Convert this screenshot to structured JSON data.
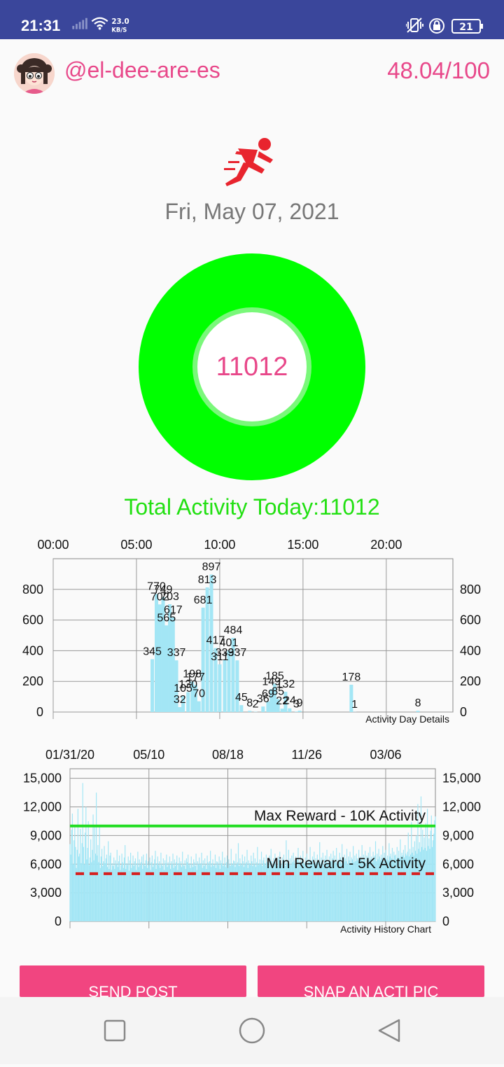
{
  "status_bar": {
    "time": "21:31",
    "net_speed_value": "23.0",
    "net_speed_unit": "KB/S",
    "battery": "21"
  },
  "profile": {
    "username": "@el-dee-are-es",
    "score": "48.04/100"
  },
  "date": "Fri, May 07, 2021",
  "activity_ring": {
    "value": "11012",
    "fill_fraction": 1.0
  },
  "total_activity": "Total Activity Today:11012",
  "colors": {
    "accent_pink": "#e8488a",
    "ring_green": "#00ff00",
    "bar_cyan": "#a3e6f5",
    "max_line": "#22dd22",
    "min_line": "#d62020",
    "status_bar": "#3a469b"
  },
  "chart_data": [
    {
      "type": "bar",
      "caption": "Activity Day Details",
      "x_ticks": [
        "00:00",
        "05:00",
        "10:00",
        "15:00",
        "20:00"
      ],
      "x_range_hours": [
        0,
        24
      ],
      "y_ticks": [
        "0",
        "200",
        "400",
        "600",
        "800"
      ],
      "ylim": [
        0,
        1000
      ],
      "bar_width_hours": 0.21,
      "bars": [
        {
          "t": 5.95,
          "v": 345,
          "label": "345"
        },
        {
          "t": 6.2,
          "v": 770,
          "label": "770"
        },
        {
          "t": 6.4,
          "v": 702,
          "label": "702"
        },
        {
          "t": 6.6,
          "v": 749,
          "label": "749"
        },
        {
          "t": 6.8,
          "v": 565,
          "label": "565"
        },
        {
          "t": 7.0,
          "v": 703,
          "label": "703"
        },
        {
          "t": 7.2,
          "v": 617,
          "label": "617"
        },
        {
          "t": 7.4,
          "v": 337,
          "label": "337"
        },
        {
          "t": 7.6,
          "v": 32,
          "label": "32"
        },
        {
          "t": 7.8,
          "v": 105,
          "label": "105"
        },
        {
          "t": 8.1,
          "v": 130,
          "label": "130"
        },
        {
          "t": 8.35,
          "v": 198,
          "label": "198"
        },
        {
          "t": 8.55,
          "v": 177,
          "label": "177"
        },
        {
          "t": 8.75,
          "v": 70,
          "label": "70"
        },
        {
          "t": 9.0,
          "v": 681,
          "label": "681"
        },
        {
          "t": 9.25,
          "v": 813,
          "label": "813"
        },
        {
          "t": 9.5,
          "v": 897,
          "label": "897"
        },
        {
          "t": 9.75,
          "v": 417,
          "label": "417"
        },
        {
          "t": 10.0,
          "v": 311,
          "label": "311"
        },
        {
          "t": 10.3,
          "v": 339,
          "label": "339"
        },
        {
          "t": 10.55,
          "v": 401,
          "label": "401"
        },
        {
          "t": 10.8,
          "v": 484,
          "label": "484"
        },
        {
          "t": 11.05,
          "v": 337,
          "label": "337"
        },
        {
          "t": 11.3,
          "v": 45,
          "label": "45"
        },
        {
          "t": 11.8,
          "v": 8,
          "label": "8"
        },
        {
          "t": 12.15,
          "v": 2,
          "label": "2"
        },
        {
          "t": 12.6,
          "v": 36,
          "label": "36"
        },
        {
          "t": 12.9,
          "v": 69,
          "label": "69"
        },
        {
          "t": 13.1,
          "v": 149,
          "label": "149"
        },
        {
          "t": 13.3,
          "v": 185,
          "label": "185"
        },
        {
          "t": 13.5,
          "v": 85,
          "label": "85"
        },
        {
          "t": 13.75,
          "v": 22,
          "label": "22"
        },
        {
          "t": 13.95,
          "v": 132,
          "label": "132"
        },
        {
          "t": 14.2,
          "v": 24,
          "label": "24"
        },
        {
          "t": 14.6,
          "v": 3,
          "label": "3"
        },
        {
          "t": 14.8,
          "v": 9,
          "label": "9"
        },
        {
          "t": 17.9,
          "v": 178,
          "label": "178"
        },
        {
          "t": 18.1,
          "v": 1,
          "label": "1"
        },
        {
          "t": 21.9,
          "v": 8,
          "label": "8"
        }
      ]
    },
    {
      "type": "bar",
      "caption": "Activity History Chart",
      "x_ticks": [
        "01/31/20",
        "05/10",
        "08/18",
        "11/26",
        "03/06"
      ],
      "ylim": [
        0,
        16000
      ],
      "y_ticks": [
        "0",
        "3,000",
        "6,000",
        "9,000",
        "12,000",
        "15,000"
      ],
      "first_date": "01/31/20",
      "last_date": "05/07/21",
      "days": 463,
      "bar_width_days": 0.6,
      "values": [
        8100,
        7000,
        9600,
        11300,
        6000,
        8500,
        9900,
        7800,
        5600,
        7500,
        11800,
        6800,
        7100,
        9700,
        6100,
        8200,
        14500,
        7800,
        6000,
        9300,
        12000,
        6500,
        7700,
        10500,
        5900,
        6700,
        8600,
        6200,
        7500,
        11200,
        6400,
        9900,
        7100,
        13500,
        6900,
        8000,
        6200,
        10100,
        5600,
        6800,
        7600,
        5800,
        6300,
        7900,
        6100,
        6600,
        7000,
        5700,
        8400,
        5500,
        6900,
        7200,
        5400,
        6100,
        5800,
        6700,
        5500,
        6400,
        6000,
        7500,
        5700,
        6300,
        6900,
        5400,
        5900,
        7100,
        6200,
        5600,
        6700,
        8000,
        5500,
        6100,
        5900,
        6800,
        5300,
        6400,
        7200,
        5600,
        6000,
        6900,
        5800,
        6300,
        6600,
        5400,
        6100,
        7300,
        5700,
        6500,
        5900,
        6200,
        6800,
        5500,
        7000,
        6000,
        5800,
        6400,
        7100,
        5600,
        6300,
        5900,
        6700,
        5400,
        6200,
        6900,
        5700,
        6000,
        6500,
        7400,
        5500,
        6100,
        6800,
        5900,
        6300,
        5600,
        7200,
        6000,
        5800,
        6600,
        5400,
        6400,
        6100,
        7000,
        5700,
        6200,
        5900,
        6800,
        5500,
        6300,
        6000,
        7100,
        5600,
        6500,
        5800,
        6200,
        6900,
        5400,
        6100,
        6700,
        5900,
        6300,
        5700,
        7300,
        6000,
        5800,
        6400,
        5500,
        6600,
        6200,
        7000,
        5900,
        6100,
        5600,
        6800,
        6000,
        5700,
        6500,
        6200,
        5800,
        7100,
        5400,
        6300,
        6000,
        6700,
        5900,
        6100,
        7200,
        5600,
        6400,
        5800,
        6600,
        6000,
        5500,
        6900,
        6200,
        5900,
        6300,
        7400,
        5700,
        6100,
        6500,
        5800,
        6000,
        7000,
        5600,
        6300,
        6200,
        5900,
        6800,
        5500,
        6400,
        6100,
        7300,
        5800,
        6000,
        6700,
        5700,
        6200,
        6900,
        5600,
        6500,
        6000,
        5800,
        7600,
        6100,
        5900,
        6400,
        6300,
        5700,
        7100,
        6000,
        6200,
        8200,
        5800,
        6600,
        6100,
        5900,
        7000,
        6300,
        5700,
        6800,
        6000,
        6200,
        7500,
        5600,
        6400,
        6100,
        5900,
        6900,
        6300,
        5800,
        7200,
        6000,
        6600,
        5700,
        6200,
        7800,
        5900,
        6100,
        6500,
        6000,
        7300,
        5800,
        6400,
        6700,
        6100,
        5900,
        7000,
        6200,
        6500,
        5800,
        6900,
        6000,
        7600,
        6300,
        5900,
        6600,
        6200,
        7100,
        6000,
        6400,
        5800,
        6800,
        6500,
        7300,
        6100,
        5900,
        6700,
        6200,
        7000,
        6400,
        5800,
        8500,
        6100,
        6300,
        7500,
        6000,
        6600,
        5900,
        6900,
        6200,
        7200,
        6400,
        6000,
        6800,
        5800,
        6500,
        7700,
        6100,
        6300,
        6900,
        5900,
        6600,
        7400,
        6200,
        6000,
        6700,
        6300,
        7100,
        5900,
        6500,
        6200,
        7800,
        6000,
        6400,
        6800,
        6100,
        7300,
        5900,
        6600,
        6200,
        7000,
        6400,
        6100,
        8300,
        6000,
        6700,
        6300,
        7200,
        5900,
        6500,
        6900,
        6200,
        7500,
        6100,
        6400,
        6800,
        6000,
        7100,
        6300,
        6600,
        7400,
        6100,
        6900,
        6200,
        7700,
        6000,
        6500,
        6300,
        7200,
        6700,
        6100,
        8100,
        6400,
        6200,
        7000,
        6600,
        6300,
        7600,
        6000,
        6800,
        6400,
        7300,
        6100,
        6700,
        6500,
        7900,
        6200,
        6900,
        6300,
        7100,
        6600,
        6400,
        7500,
        6200,
        6800,
        6500,
        8000,
        6300,
        7000,
        6600,
        7400,
        6100,
        6900,
        6700,
        7200,
        6400,
        7800,
        6500,
        6800,
        6200,
        7300,
        6700,
        6900,
        8400,
        6300,
        7100,
        6500,
        7600,
        6800,
        6400,
        7000,
        6600,
        7900,
        6300,
        7200,
        6700,
        7500,
        6500,
        6900,
        6400,
        8200,
        6800,
        7100,
        6600,
        7700,
        6400,
        7300,
        6900,
        7000,
        6500,
        7800,
        6700,
        7400,
        6600,
        8600,
        6800,
        7200,
        6900,
        7500,
        6700,
        8000,
        7100,
        6900,
        7300,
        9300,
        6800,
        7600,
        7000,
        10400,
        7200,
        7800,
        6900,
        8400,
        7400,
        9000,
        7100,
        12300,
        7600,
        8300,
        7300,
        13100,
        7800,
        9600,
        7500,
        8800,
        7700,
        10300,
        7400,
        11800,
        7900,
        8700,
        7600,
        9500,
        11100,
        7800,
        8500,
        9200,
        10600,
        11000
      ]
    }
  ],
  "reference_lines": {
    "max": {
      "label": "Max Reward - 10K Activity",
      "value": 10000
    },
    "min": {
      "label": "Min Reward - 5K Activity",
      "value": 5000
    }
  },
  "buttons": {
    "send_post": "SEND POST",
    "snap_pic": "SNAP AN ACTI PIC"
  },
  "nav": {
    "recents": "square-icon",
    "home": "circle-icon",
    "back": "triangle-back-icon"
  }
}
